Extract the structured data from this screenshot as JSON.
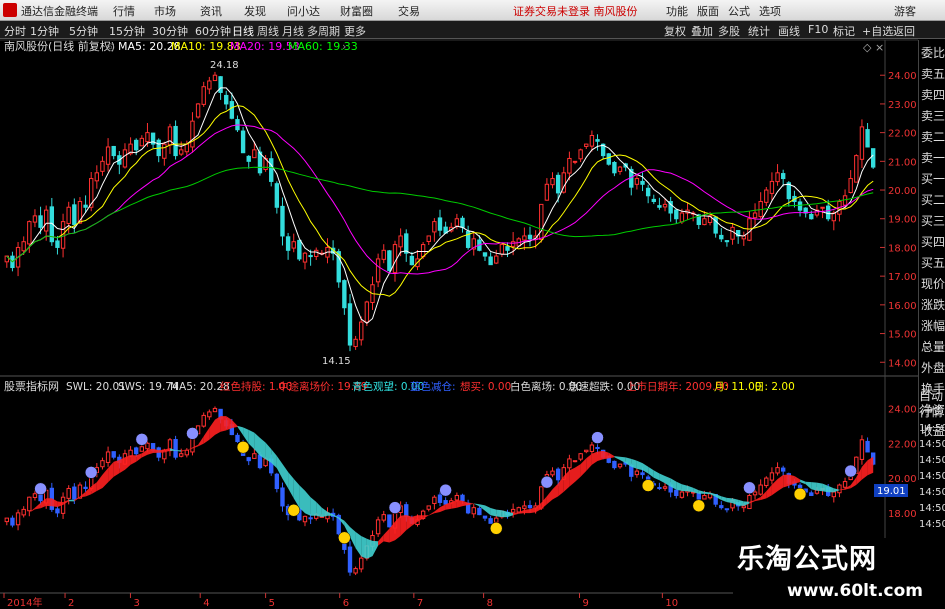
{
  "menubar": {
    "app_title": "通达信金融终端",
    "items": [
      "行情",
      "市场",
      "资讯",
      "发现",
      "问小达",
      "财富圈",
      "交易"
    ],
    "notice": "证券交易未登录  南风股份",
    "right_items": [
      "功能",
      "版面",
      "公式",
      "选项",
      "游客"
    ]
  },
  "toolbar": {
    "periods": [
      "分时",
      "1分钟",
      "5分钟",
      "15分钟",
      "30分钟",
      "60分钟",
      "日线",
      "周线",
      "月线",
      "多周期",
      "更多"
    ],
    "active_period": "日线",
    "right_items": [
      "复权",
      "叠加",
      "多股",
      "统计",
      "画线",
      "F10",
      "标记",
      "+自选",
      "返回"
    ]
  },
  "main_panel": {
    "title": "南风股份(日线 前复权)",
    "ma": [
      {
        "label": "MA5: 20.28",
        "color": "#ffffff"
      },
      {
        "label": "MA10: 19.83",
        "color": "#ffff00"
      },
      {
        "label": "MA20: 19.53",
        "color": "#ff00ff"
      },
      {
        "label": "MA60: 19.33",
        "color": "#00ff00"
      }
    ],
    "y_ticks": [
      "24.00",
      "23.00",
      "22.00",
      "21.00",
      "20.00",
      "19.00",
      "18.00",
      "17.00",
      "16.00",
      "15.00",
      "14.00"
    ],
    "high_label": "24.18",
    "low_label": "14.15"
  },
  "indicator_panel": {
    "title": "股票指标网",
    "items": [
      {
        "label": "SWL: 20.01",
        "color": "#dddddd"
      },
      {
        "label": "SWS: 19.74",
        "color": "#dddddd"
      },
      {
        "label": "MA5: 20.28",
        "color": "#dddddd"
      },
      {
        "label": "红色持股: 1.00",
        "color": "#ff3030"
      },
      {
        "label": "中途离场价: 19.89",
        "color": "#ff3030"
      },
      {
        "label": "青色观望: 0.00",
        "color": "#30e0e0"
      },
      {
        "label": "蓝色减仓: ",
        "color": "#3060ff"
      },
      {
        "label": "想买: 0.00",
        "color": "#ff3030"
      },
      {
        "label": "白色离场: 0.00",
        "color": "#dddddd"
      },
      {
        "label": "急速超跌: 0.00",
        "color": "#dddddd"
      },
      {
        "label": "上市日期年: 2009.00",
        "color": "#ff3030"
      },
      {
        "label": "月: 11.00",
        "color": "#ffff00"
      },
      {
        "label": "日: 2.00",
        "color": "#ffff00"
      }
    ],
    "y_ticks": [
      "24.00",
      "22.00",
      "20.00",
      "18.00"
    ],
    "price_badge": "19.01"
  },
  "x_axis": [
    "2014年",
    "2",
    "3",
    "4",
    "5",
    "6",
    "7",
    "8",
    "9",
    "10"
  ],
  "right_panel": {
    "top": [
      "委比",
      "卖五",
      "卖四",
      "卖三",
      "卖二",
      "卖一",
      "买一",
      "买二",
      "买三",
      "买四",
      "买五",
      "现价",
      "涨跌",
      "涨幅",
      "总量",
      "外盘",
      "换手",
      "净资",
      "收益"
    ],
    "bottom": [
      "自动",
      "行情",
      "14:50",
      "14:50",
      "14:50",
      "14:50",
      "14:50",
      "14:50",
      "14:50"
    ]
  },
  "watermark": {
    "cn": "乐淘公式网",
    "url": "www.60lt.com"
  },
  "chart_data": {
    "type": "candlestick",
    "main_ylim": [
      13.8,
      24.6
    ],
    "closes": [
      17.7,
      17.3,
      18.0,
      18.2,
      18.9,
      19.1,
      18.7,
      19.3,
      18.2,
      18.0,
      18.9,
      19.4,
      18.8,
      19.6,
      19.4,
      20.4,
      20.6,
      21.0,
      21.5,
      21.2,
      20.9,
      21.4,
      21.6,
      21.4,
      21.8,
      22.0,
      21.6,
      21.2,
      21.6,
      22.2,
      21.2,
      21.4,
      21.6,
      22.4,
      23.0,
      23.6,
      23.8,
      24.0,
      23.4,
      23.0,
      22.5,
      22.1,
      21.3,
      21.0,
      21.4,
      20.6,
      21.1,
      20.3,
      19.4,
      18.4,
      17.9,
      18.2,
      17.6,
      17.8,
      17.7,
      17.9,
      17.8,
      18.0,
      17.8,
      16.8,
      15.9,
      14.6,
      14.8,
      15.4,
      16.1,
      16.7,
      17.6,
      17.9,
      17.2,
      18.1,
      18.4,
      17.8,
      17.4,
      17.6,
      18.1,
      18.4,
      18.9,
      18.6,
      18.5,
      18.7,
      19.0,
      18.7,
      18.0,
      18.3,
      17.9,
      17.7,
      17.4,
      17.7,
      18.1,
      17.9,
      18.2,
      18.3,
      18.4,
      18.3,
      18.4,
      19.5,
      20.2,
      20.4,
      19.9,
      20.6,
      21.1,
      21.0,
      21.4,
      21.6,
      21.9,
      21.7,
      21.2,
      20.9,
      20.6,
      20.8,
      20.8,
      20.1,
      20.4,
      20.2,
      19.8,
      19.6,
      19.4,
      19.5,
      19.2,
      19.0,
      19.2,
      19.3,
      19.2,
      18.8,
      19.0,
      19.1,
      18.5,
      18.3,
      18.2,
      18.7,
      18.4,
      18.4,
      19.0,
      19.2,
      19.6,
      20.0,
      20.3,
      20.6,
      20.4,
      19.7,
      19.6,
      19.3,
      19.2,
      19.0,
      19.3,
      19.4,
      19.0,
      19.2,
      19.6,
      19.8,
      20.4,
      21.2,
      22.2,
      21.5,
      20.8
    ]
  }
}
